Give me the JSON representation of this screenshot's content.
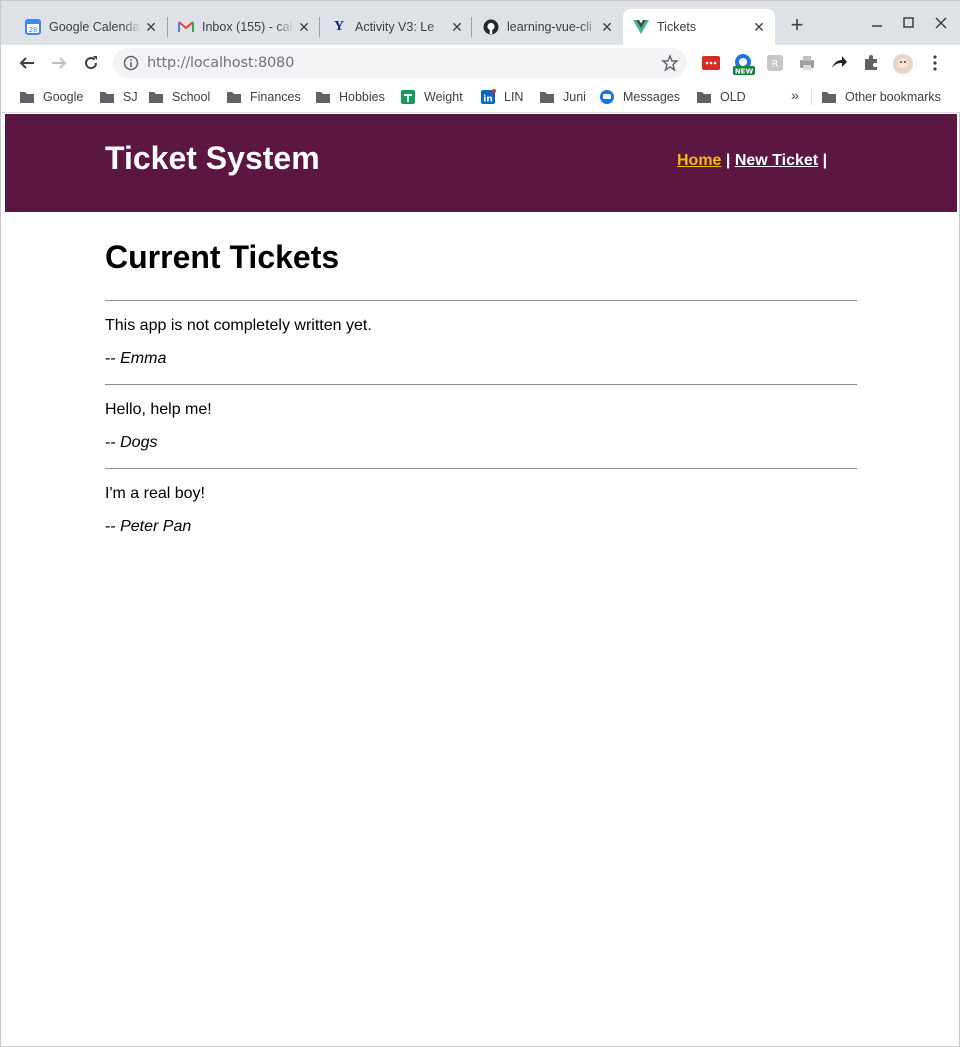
{
  "browser": {
    "tabs": [
      {
        "title": "Google Calendar",
        "icon": "google-calendar-icon",
        "active": false
      },
      {
        "title": "Inbox (155) - cal",
        "icon": "gmail-icon",
        "active": false
      },
      {
        "title": "Activity V3: Le",
        "icon": "yale-icon",
        "active": false
      },
      {
        "title": "learning-vue-cli",
        "icon": "github-icon",
        "active": false
      },
      {
        "title": "Tickets",
        "icon": "vue-icon",
        "active": true
      }
    ],
    "calendar_day": "28",
    "url_host": "http://localhost",
    "url_port": ":8080",
    "ext_badge": "NEW",
    "bookmarks": [
      {
        "label": "Google",
        "icon": "folder-icon"
      },
      {
        "label": "SJ",
        "icon": "folder-icon"
      },
      {
        "label": "School",
        "icon": "folder-icon"
      },
      {
        "label": "Finances",
        "icon": "folder-icon"
      },
      {
        "label": "Hobbies",
        "icon": "folder-icon"
      },
      {
        "label": "Weight",
        "icon": "sheets-icon"
      },
      {
        "label": "LIN",
        "icon": "linkedin-icon"
      },
      {
        "label": "Juni",
        "icon": "folder-icon"
      },
      {
        "label": "Messages",
        "icon": "messages-icon"
      },
      {
        "label": "OLD",
        "icon": "folder-icon"
      }
    ],
    "bookmarks_more": "»",
    "other_bookmarks": "Other bookmarks"
  },
  "site": {
    "title": "Ticket System",
    "nav": {
      "home": "Home",
      "sep1": " | ",
      "new_ticket": "New Ticket",
      "sep2": " |"
    },
    "colors": {
      "header_bg": "#5b1642",
      "home_link": "#f5b90f"
    }
  },
  "main": {
    "heading": "Current Tickets",
    "tickets": [
      {
        "problem": "This app is not completely written yet.",
        "name": "Emma"
      },
      {
        "problem": "Hello, help me!",
        "name": "Dogs"
      },
      {
        "problem": "I'm a real boy!",
        "name": "Peter Pan"
      }
    ],
    "name_prefix": "-- "
  }
}
